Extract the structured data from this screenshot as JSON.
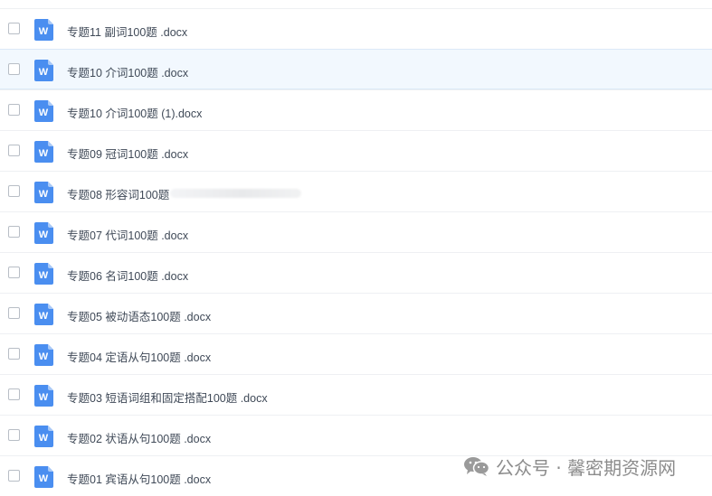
{
  "files": [
    {
      "name": "专题11 副词100题 .docx",
      "icon": "word-file-icon"
    },
    {
      "name": "专题10 介词100题 .docx",
      "icon": "word-file-icon",
      "highlighted": true
    },
    {
      "name": "专题10 介词100题 (1).docx",
      "icon": "word-file-icon"
    },
    {
      "name": "专题09 冠词100题 .docx",
      "icon": "word-file-icon"
    },
    {
      "name": "专题08 形容词100题",
      "icon": "word-file-icon",
      "obscured_suffix": true
    },
    {
      "name": "专题07 代词100题 .docx",
      "icon": "word-file-icon"
    },
    {
      "name": "专题06 名词100题 .docx",
      "icon": "word-file-icon"
    },
    {
      "name": "专题05 被动语态100题 .docx",
      "icon": "word-file-icon"
    },
    {
      "name": "专题04 定语从句100题 .docx",
      "icon": "word-file-icon"
    },
    {
      "name": "专题03 短语词组和固定搭配100题 .docx",
      "icon": "word-file-icon"
    },
    {
      "name": "专题02 状语从句100题 .docx",
      "icon": "word-file-icon"
    },
    {
      "name": "专题01 宾语从句100题 .docx",
      "icon": "word-file-icon"
    }
  ],
  "watermark": {
    "text": "公众号 · 馨密期资源网",
    "icon": "wechat-icon"
  },
  "colors": {
    "word_blue": "#4a8ef0",
    "row_hover_bg": "#f2f8fe",
    "text": "#3f4957"
  }
}
